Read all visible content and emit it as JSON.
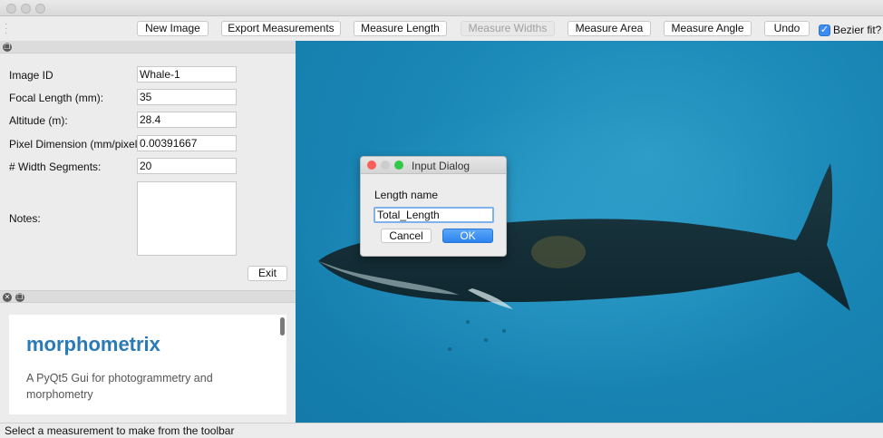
{
  "toolbar": {
    "buttons": [
      {
        "label": "New Image",
        "enabled": true
      },
      {
        "label": "Export Measurements",
        "enabled": true
      },
      {
        "label": "Measure Length",
        "enabled": true
      },
      {
        "label": "Measure Widths",
        "enabled": false
      },
      {
        "label": "Measure Area",
        "enabled": true
      },
      {
        "label": "Measure Angle",
        "enabled": true
      },
      {
        "label": "Undo",
        "enabled": true
      }
    ],
    "bezier": {
      "label": "Bezier fit?",
      "checked": true
    }
  },
  "form": {
    "image_id": {
      "label": "Image ID",
      "value": "Whale-1"
    },
    "focal_length": {
      "label": "Focal Length (mm):",
      "value": "35"
    },
    "altitude": {
      "label": "Altitude (m):",
      "value": "28.4"
    },
    "pixel_dimension": {
      "label": "Pixel Dimension (mm/pixel)",
      "value": "0.00391667"
    },
    "width_segments": {
      "label": "# Width Segments:",
      "value": "20"
    },
    "notes": {
      "label": "Notes:",
      "value": ""
    },
    "exit_label": "Exit"
  },
  "info": {
    "title": "morphometrix",
    "description": "A PyQt5 Gui for photogrammetry and morphometry"
  },
  "dialog": {
    "title": "Input Dialog",
    "prompt": "Length name",
    "value": "Total_Length",
    "cancel_label": "Cancel",
    "ok_label": "OK"
  },
  "status": "Select a measurement to make from the toolbar",
  "colors": {
    "ocean": "#1a87b6",
    "brand": "#2a7ab8",
    "accent": "#3b8bf1"
  }
}
